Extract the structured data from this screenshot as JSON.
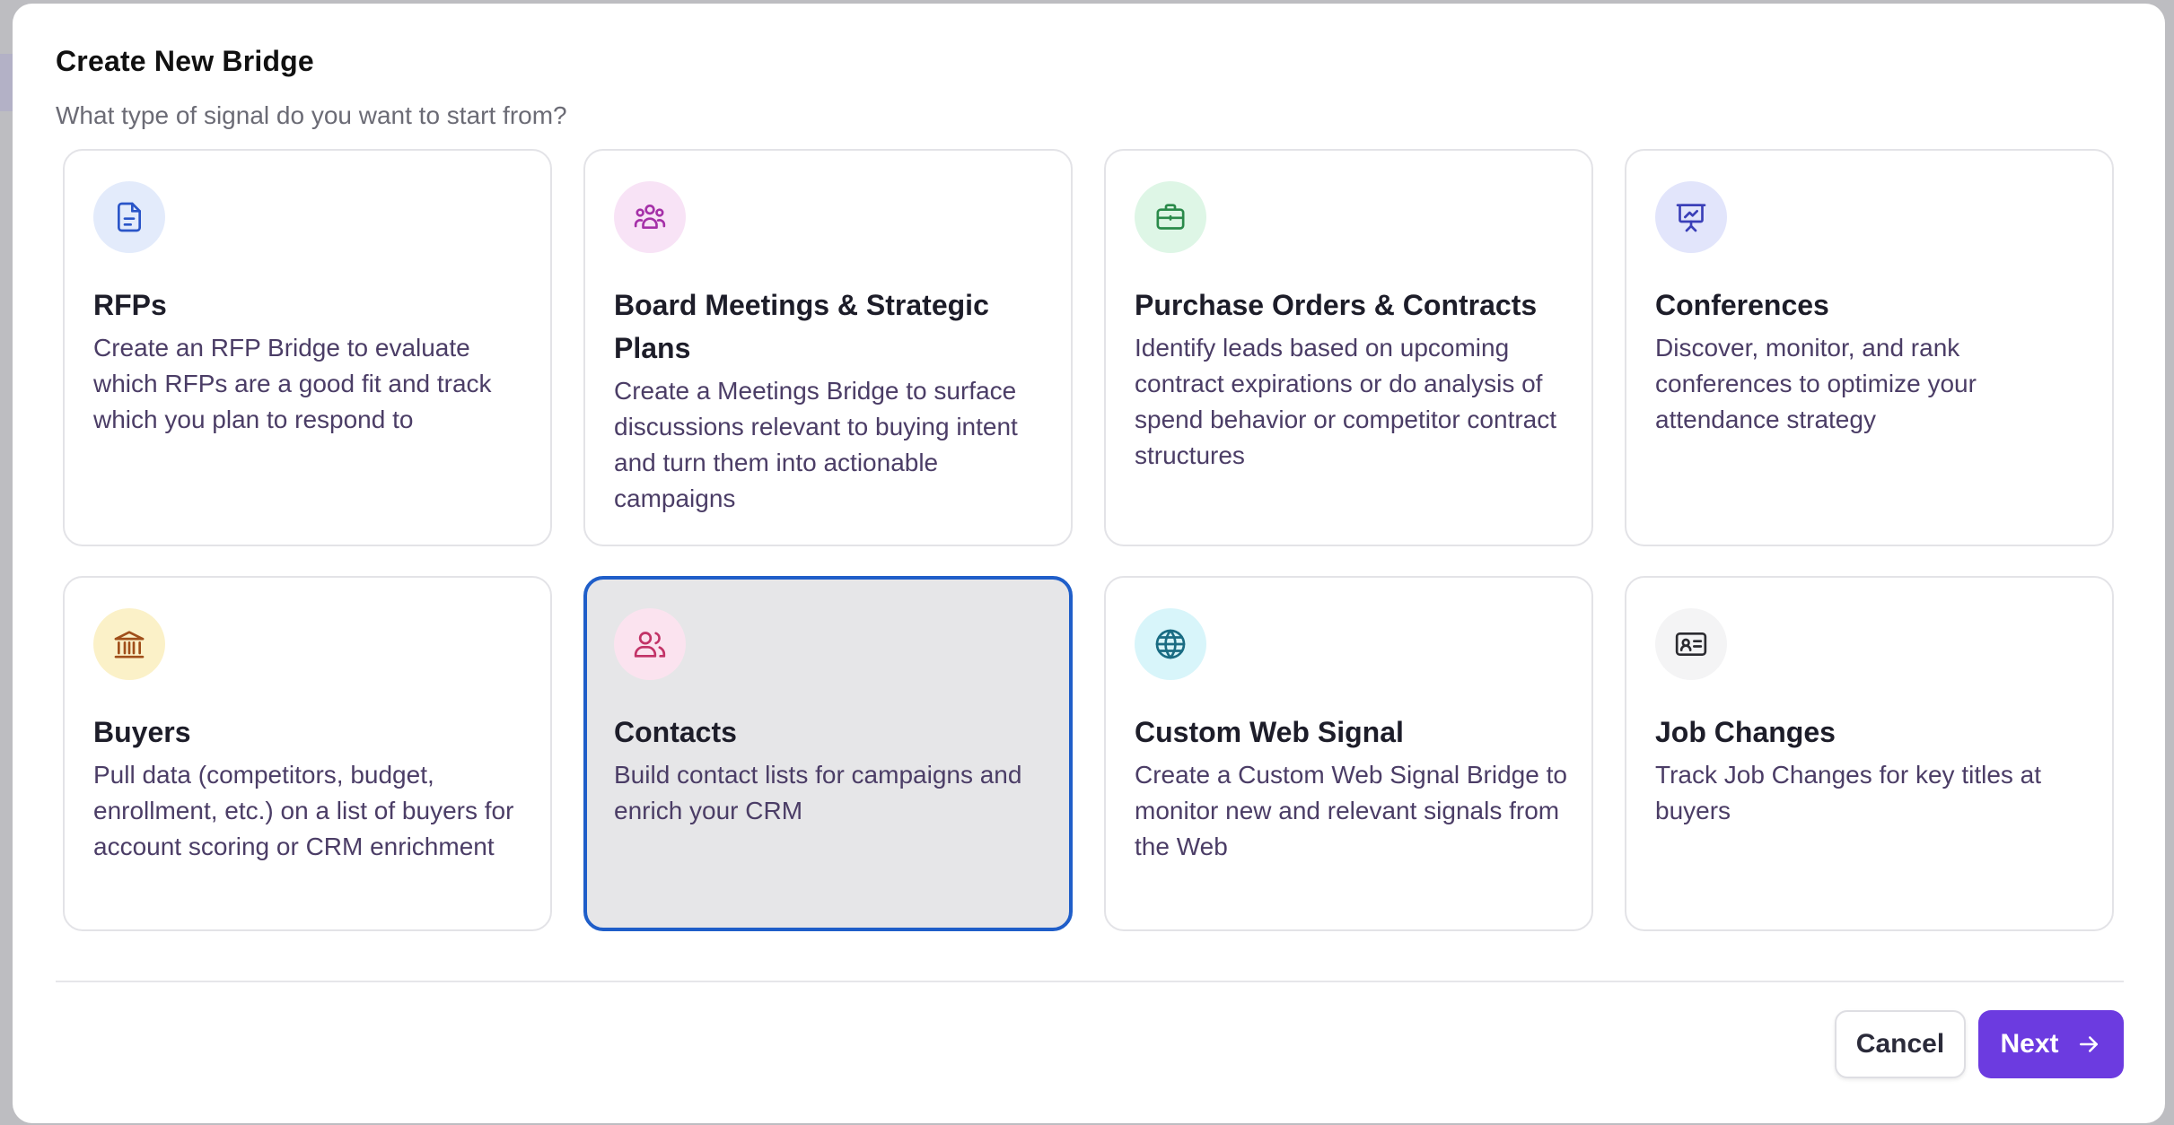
{
  "modal": {
    "title": "Create New Bridge",
    "subtitle": "What type of signal do you want to start from?"
  },
  "cards": [
    {
      "title": "RFPs",
      "description": "Create an RFP Bridge to evaluate which RFPs are a good fit and track which you plan to respond to",
      "icon": "document-icon",
      "icon_bg": "#e3ebfb",
      "icon_color": "#2a55c8"
    },
    {
      "title": "Board Meetings & Strategic Plans",
      "description": "Create a Meetings Bridge to surface discussions relevant to buying intent and turn them into actionable campaigns",
      "icon": "group-icon",
      "icon_bg": "#f8e3f6",
      "icon_color": "#a530a8"
    },
    {
      "title": "Purchase Orders & Contracts",
      "description": "Identify leads based on upcoming contract expirations or do analysis of spend behavior or competitor contract structures",
      "icon": "briefcase-icon",
      "icon_bg": "#def6e6",
      "icon_color": "#2a8a4a"
    },
    {
      "title": "Conferences",
      "description": "Discover, monitor, and rank conferences to optimize your attendance strategy",
      "icon": "presentation-icon",
      "icon_bg": "#e2e5fb",
      "icon_color": "#3a3fb8"
    },
    {
      "title": "Buyers",
      "description": "Pull data (competitors, budget, enrollment, etc.) on a list of buyers for account scoring or CRM enrichment",
      "icon": "bank-icon",
      "icon_bg": "#fbf1c8",
      "icon_color": "#a04f1a"
    },
    {
      "title": "Contacts",
      "description": "Build contact lists for campaigns and enrich your CRM",
      "icon": "users-icon",
      "icon_bg": "#fbe3ef",
      "icon_color": "#c23367",
      "selected": true
    },
    {
      "title": "Custom Web Signal",
      "description": "Create a Custom Web Signal Bridge to monitor new and relevant signals from the Web",
      "icon": "globe-icon",
      "icon_bg": "#d8f5fa",
      "icon_color": "#1a6c83"
    },
    {
      "title": "Job Changes",
      "description": "Track Job Changes for key titles at buyers",
      "icon": "id-card-icon",
      "icon_bg": "#f4f4f5",
      "icon_color": "#2b2b30"
    }
  ],
  "footer": {
    "cancel_label": "Cancel",
    "next_label": "Next",
    "next_icon": "arrow-right-icon"
  },
  "colors": {
    "accent": "#6c3be0",
    "selected_border": "#1f5ec9"
  }
}
